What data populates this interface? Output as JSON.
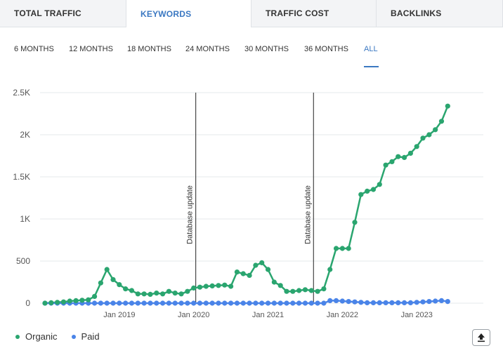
{
  "tabs": [
    {
      "label": "TOTAL TRAFFIC",
      "active": false
    },
    {
      "label": "KEYWORDS",
      "active": true
    },
    {
      "label": "TRAFFIC COST",
      "active": false
    },
    {
      "label": "BACKLINKS",
      "active": false
    }
  ],
  "periods": [
    {
      "label": "6 MONTHS",
      "active": false
    },
    {
      "label": "12 MONTHS",
      "active": false
    },
    {
      "label": "18 MONTHS",
      "active": false
    },
    {
      "label": "24 MONTHS",
      "active": false
    },
    {
      "label": "30 MONTHS",
      "active": false
    },
    {
      "label": "36 MONTHS",
      "active": false
    },
    {
      "label": "ALL",
      "active": true
    }
  ],
  "legend": {
    "organic": "Organic",
    "paid": "Paid"
  },
  "export": {
    "icon": "export-icon"
  },
  "colors": {
    "accent": "#3b78c2",
    "organic": "#2aa56f",
    "paid": "#4a84e8",
    "grid": "#e6e8eb"
  },
  "chart_data": {
    "type": "line",
    "ylim": [
      0,
      2500
    ],
    "yticks": [
      {
        "value": 0,
        "label": "0"
      },
      {
        "value": 500,
        "label": "500"
      },
      {
        "value": 1000,
        "label": "1K"
      },
      {
        "value": 1500,
        "label": "1.5K"
      },
      {
        "value": 2000,
        "label": "2K"
      },
      {
        "value": 2500,
        "label": "2.5K"
      }
    ],
    "xticks": [
      "Jan 2019",
      "Jan 2020",
      "Jan 2021",
      "Jan 2022",
      "Jan 2023"
    ],
    "annotations": [
      {
        "label": "Database update",
        "month_index": 24
      },
      {
        "label": "Database update",
        "month_index": 43
      }
    ],
    "x_start": "2018-01",
    "series": [
      {
        "name": "Organic",
        "color": "#2aa56f",
        "values": [
          0,
          5,
          10,
          15,
          25,
          30,
          35,
          40,
          80,
          240,
          400,
          280,
          220,
          170,
          150,
          110,
          110,
          105,
          120,
          110,
          140,
          120,
          110,
          140,
          180,
          190,
          200,
          205,
          210,
          215,
          200,
          370,
          350,
          330,
          450,
          480,
          400,
          250,
          210,
          140,
          140,
          150,
          160,
          150,
          140,
          170,
          400,
          650,
          650,
          650,
          960,
          1290,
          1330,
          1350,
          1410,
          1640,
          1680,
          1740,
          1730,
          1780,
          1860,
          1960,
          2000,
          2060,
          2160,
          2340
        ]
      },
      {
        "name": "Paid",
        "color": "#4a84e8",
        "values": [
          0,
          0,
          0,
          0,
          0,
          0,
          0,
          0,
          0,
          0,
          0,
          0,
          0,
          0,
          0,
          0,
          0,
          0,
          0,
          0,
          0,
          0,
          0,
          0,
          0,
          0,
          0,
          0,
          0,
          0,
          0,
          0,
          0,
          0,
          0,
          0,
          0,
          0,
          0,
          0,
          0,
          0,
          0,
          0,
          0,
          0,
          30,
          30,
          25,
          20,
          15,
          10,
          5,
          5,
          5,
          5,
          5,
          5,
          5,
          5,
          10,
          15,
          20,
          25,
          30,
          20
        ]
      }
    ]
  }
}
